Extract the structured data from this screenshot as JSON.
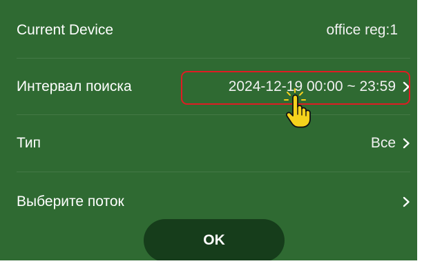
{
  "settings": {
    "rows": [
      {
        "label": "Current Device",
        "value": "office reg:1"
      },
      {
        "label": "Интервал поиска",
        "value": "2024-12-19 00:00 ~ 23:59"
      },
      {
        "label": "Тип",
        "value": "Все"
      },
      {
        "label": "Выберите поток",
        "value": ""
      }
    ]
  },
  "buttons": {
    "ok": "OK"
  },
  "icons": {
    "chevron": "chevron-right-icon",
    "cursor": "hand-pointer-cursor-icon"
  },
  "colors": {
    "panel_bg": "#2f6a32",
    "button_bg": "#163d1b",
    "highlight": "#e01b23",
    "text": "#ffffff"
  }
}
